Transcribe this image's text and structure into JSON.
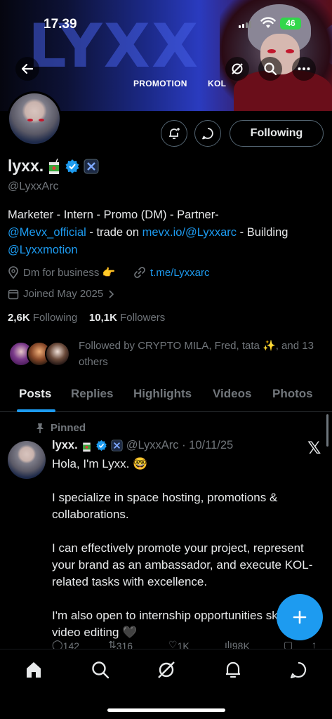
{
  "status_bar": {
    "time": "17.39",
    "battery": "46"
  },
  "banner": {
    "big_text": "LYXX ARC",
    "tag_left": "PROMOTION",
    "tag_right": "KOL"
  },
  "header": {
    "following_label": "Following"
  },
  "profile": {
    "name": "lyxx.",
    "handle": "@LyxxArc",
    "bio_line1": "Marketer - Intern - Promo (DM) - Partner-",
    "bio_mention1": "@Mevx_official",
    "bio_mid": " - trade on ",
    "bio_link": "mevx.io/@Lyxxarc",
    "bio_after_link": " - Building",
    "bio_mention2": "@Lyxxmotion",
    "location": "Dm for business 👉",
    "website": "t.me/Lyxxarc",
    "joined": "Joined May 2025",
    "following_count": "2,6K",
    "following_label": "Following",
    "followers_count": "10,1K",
    "followers_label": "Followers",
    "followed_by": "Followed by CRYPTO MILA, Fred, tata ✨, and 13 others"
  },
  "tabs": [
    "Posts",
    "Replies",
    "Highlights",
    "Videos",
    "Photos"
  ],
  "post": {
    "pinned_label": "Pinned",
    "author_name": "lyxx.",
    "author_meta": "@LyxxArc · 10/11/25",
    "line1": "Hola, I'm Lyxx. 🤓",
    "para2": "I specialize in space hosting, promotions & collaborations.",
    "para3": "I can effectively promote your project, represent your brand as an ambassador, and execute KOL-related tasks with excellence.",
    "para4": "I'm also open to internship opportunities skilled in video editing 🖤",
    "replies": "142",
    "reposts": "316",
    "likes": "1K",
    "views": "98K"
  },
  "colors": {
    "accent": "#1d9bf0",
    "muted": "#71767b",
    "text": "#e7e9ea",
    "background": "#000000"
  }
}
